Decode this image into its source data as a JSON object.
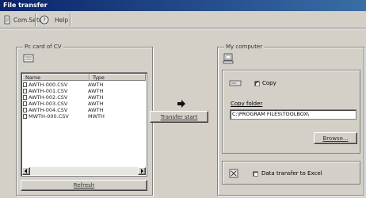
{
  "window": {
    "title": "File transfer"
  },
  "toolbar": {
    "comm_setup": "Com.Setup",
    "help": "Help"
  },
  "left_group": {
    "label": "Pc card of CV",
    "columns": [
      "Name",
      "Type"
    ],
    "rows": [
      {
        "name": "AWTH-000.CSV",
        "type": "AWTH"
      },
      {
        "name": "AWTH-001.CSV",
        "type": "AWTH"
      },
      {
        "name": "AWTH-002.CSV",
        "type": "AWTH"
      },
      {
        "name": "AWTH-003.CSV",
        "type": "AWTH"
      },
      {
        "name": "AWTH-004.CSV",
        "type": "AWTH"
      },
      {
        "name": "MWTH-000.CSV",
        "type": "MWTH"
      }
    ],
    "refresh": "Refresh"
  },
  "transfer": {
    "label": "Transfer start"
  },
  "right_group": {
    "label": "My computer",
    "copy_label": "Copy",
    "copy_checked": true,
    "copy_folder_label": "Copy folder",
    "copy_folder_value": "C:\\PROGRAM FILES\\TOOLBOX\\",
    "browse": "Browse...",
    "excel_label": "Data transfer to Excel",
    "excel_checked": false
  }
}
